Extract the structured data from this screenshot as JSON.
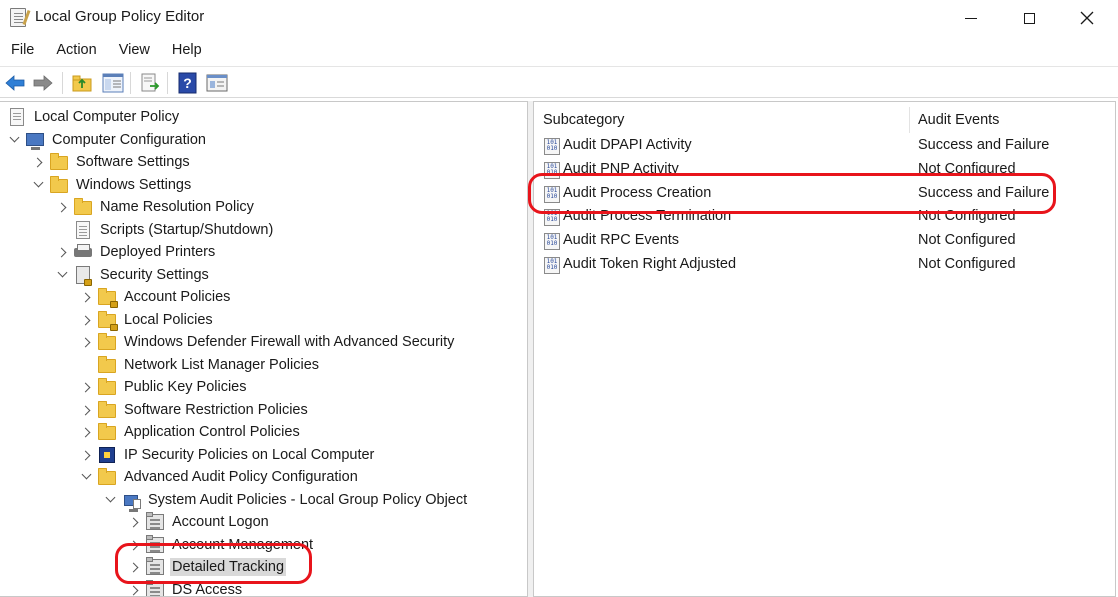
{
  "window": {
    "title": "Local Group Policy Editor",
    "icon": "policy-editor-icon"
  },
  "menubar": {
    "items": [
      "File",
      "Action",
      "View",
      "Help"
    ]
  },
  "toolbar": {
    "buttons": [
      "back-arrow-icon",
      "forward-arrow-icon",
      "up-folder-icon",
      "show-hide-tree-icon",
      "export-list-icon",
      "help-icon",
      "properties-icon"
    ]
  },
  "tree": {
    "items": [
      {
        "label": "Local Computer Policy"
      },
      {
        "label": "Computer Configuration"
      },
      {
        "label": "Software Settings"
      },
      {
        "label": "Windows Settings"
      },
      {
        "label": "Name Resolution Policy"
      },
      {
        "label": "Scripts (Startup/Shutdown)"
      },
      {
        "label": "Deployed Printers"
      },
      {
        "label": "Security Settings"
      },
      {
        "label": "Account Policies"
      },
      {
        "label": "Local Policies"
      },
      {
        "label": "Windows Defender Firewall with Advanced Security"
      },
      {
        "label": "Network List Manager Policies"
      },
      {
        "label": "Public Key Policies"
      },
      {
        "label": "Software Restriction Policies"
      },
      {
        "label": "Application Control Policies"
      },
      {
        "label": "IP Security Policies on Local Computer"
      },
      {
        "label": "Advanced Audit Policy Configuration"
      },
      {
        "label": "System Audit Policies - Local Group Policy Object"
      },
      {
        "label": "Account Logon"
      },
      {
        "label": "Account Management"
      },
      {
        "label": "Detailed Tracking"
      },
      {
        "label": "DS Access"
      }
    ]
  },
  "list": {
    "columns": [
      "Subcategory",
      "Audit Events"
    ],
    "rows": [
      {
        "name": "Audit DPAPI Activity",
        "value": "Success and Failure"
      },
      {
        "name": "Audit PNP Activity",
        "value": "Not Configured"
      },
      {
        "name": "Audit Process Creation",
        "value": "Success and Failure"
      },
      {
        "name": "Audit Process Termination",
        "value": "Not Configured"
      },
      {
        "name": "Audit RPC Events",
        "value": "Not Configured"
      },
      {
        "name": "Audit Token Right Adjusted",
        "value": "Not Configured"
      }
    ],
    "icon_text": "101\n010"
  },
  "colors": {
    "highlight": "#e8141b",
    "selection": "#d9d9d9"
  }
}
